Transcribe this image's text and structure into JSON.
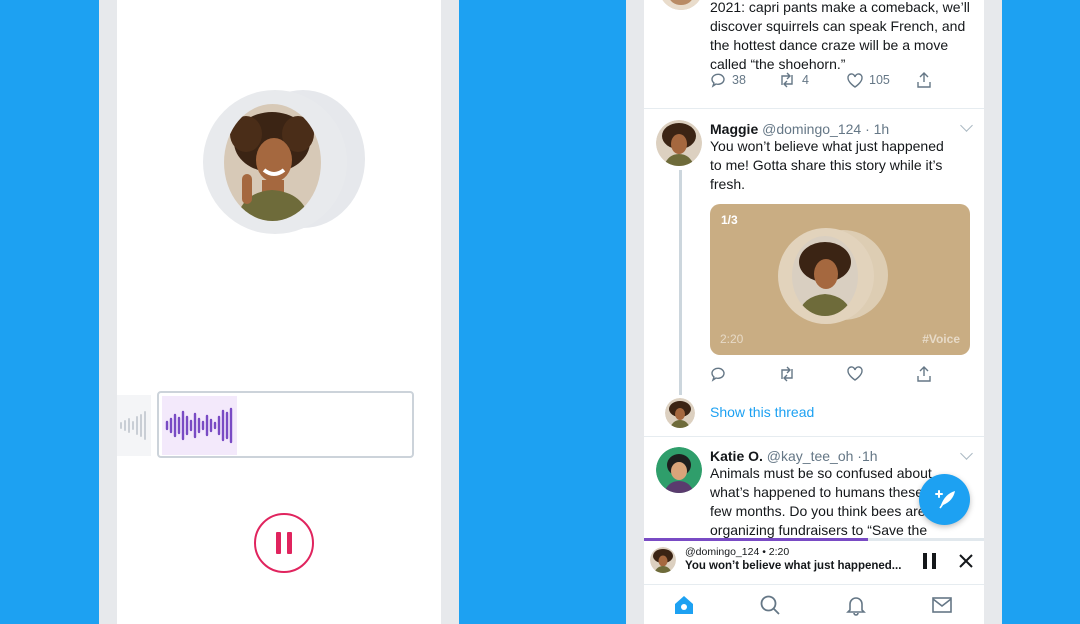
{
  "colors": {
    "brand": "#1da1f2",
    "record": "#e0245e",
    "wave": "#794bc4",
    "card": "#c9ad83"
  },
  "left_phone": {
    "avatar": "woman-curly-hair-avatar",
    "recording_progress": 0.3
  },
  "right_phone": {
    "tweet1": {
      "text": "2021: capri pants make a comeback, we’ll discover squirrels can speak French, and the hottest dance craze will be a move called “the shoehorn.”",
      "replies": "38",
      "retweets": "4",
      "likes": "105"
    },
    "tweet2": {
      "name": "Maggie",
      "handle": "@domingo_124",
      "time": "· 1h",
      "text": "You won’t believe what just happened to me! Gotta share this story while it’s fresh.",
      "card": {
        "count": "1/3",
        "duration": "2:20",
        "tag": "#Voice"
      },
      "show_thread": "Show this thread"
    },
    "tweet3": {
      "name": "Katie O.",
      "handle": "@kay_tee_oh",
      "time": "·1h",
      "text": "Animals must be so confused about what’s happened to humans these few months. Do you think bees are organizing fundraisers to “Save the"
    },
    "player": {
      "meta": "@domingo_124 • 2:20",
      "title": "You won’t believe what just happened...",
      "progress": 0.66
    },
    "tabs": [
      "home-icon",
      "search-icon",
      "bell-icon",
      "mail-icon"
    ]
  }
}
